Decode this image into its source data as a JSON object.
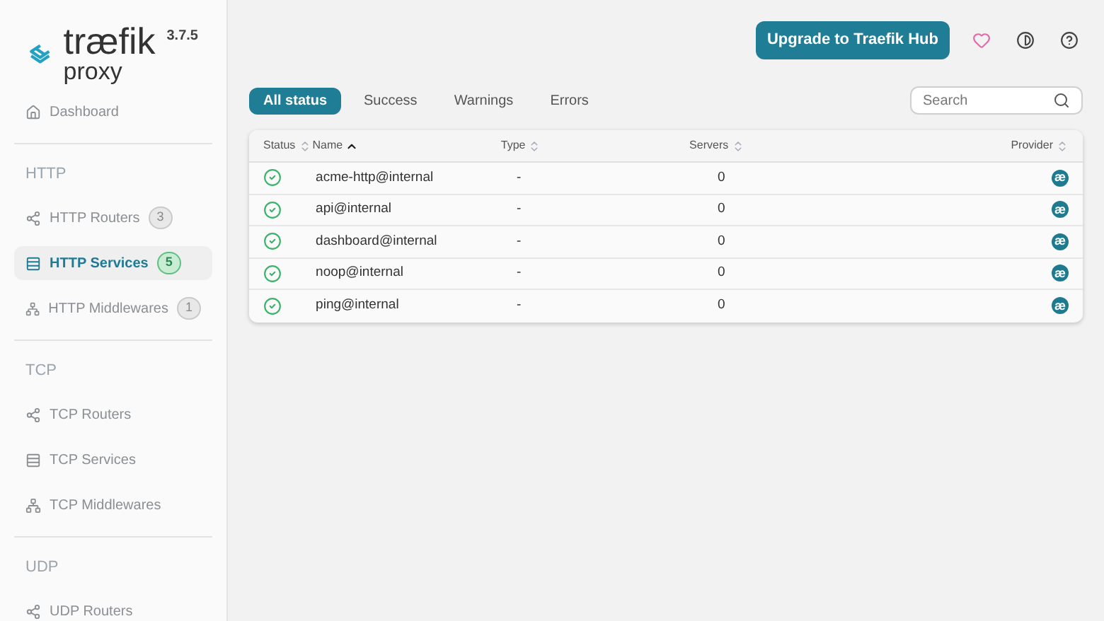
{
  "logo": {
    "name": "træfik",
    "sub": "proxy",
    "version": "3.7.5"
  },
  "sidebar": {
    "items": [
      {
        "kind": "home",
        "label": "Dashboard",
        "selected": false
      },
      {
        "kind": "section",
        "label": "HTTP"
      },
      {
        "kind": "router",
        "label": "HTTP Routers",
        "count": "3",
        "selected": false
      },
      {
        "kind": "service",
        "label": "HTTP Services",
        "count": "5",
        "selected": true
      },
      {
        "kind": "middleware",
        "label": "HTTP Middlewares",
        "count": "1",
        "selected": false
      },
      {
        "kind": "section",
        "label": "TCP"
      },
      {
        "kind": "router",
        "label": "TCP Routers",
        "selected": false
      },
      {
        "kind": "service",
        "label": "TCP Services",
        "selected": false
      },
      {
        "kind": "middleware",
        "label": "TCP Middlewares",
        "selected": false
      },
      {
        "kind": "section",
        "label": "UDP"
      },
      {
        "kind": "router",
        "label": "UDP Routers",
        "selected": false
      }
    ]
  },
  "header": {
    "upgrade_button": "Upgrade to Traefik Hub"
  },
  "tabs": [
    {
      "label": "All status",
      "selected": true
    },
    {
      "label": "Success",
      "selected": false
    },
    {
      "label": "Warnings",
      "selected": false
    },
    {
      "label": "Errors",
      "selected": false
    }
  ],
  "search": {
    "placeholder": "Search"
  },
  "table": {
    "columns": [
      {
        "label": "Status",
        "sorted": false
      },
      {
        "label": "Name",
        "sorted": true
      },
      {
        "label": "Type",
        "sorted": false
      },
      {
        "label": "Servers",
        "sorted": false
      },
      {
        "label": "Provider",
        "sorted": false
      }
    ],
    "rows": [
      {
        "kind": "success",
        "name": "acme-http@internal",
        "type": "-",
        "servers": "0",
        "provider": "æ"
      },
      {
        "kind": "success",
        "name": "api@internal",
        "type": "-",
        "servers": "0",
        "provider": "æ"
      },
      {
        "kind": "success",
        "name": "dashboard@internal",
        "type": "-",
        "servers": "0",
        "provider": "æ"
      },
      {
        "kind": "success",
        "name": "noop@internal",
        "type": "-",
        "servers": "0",
        "provider": "æ"
      },
      {
        "kind": "success",
        "name": "ping@internal",
        "type": "-",
        "servers": "0",
        "provider": "æ"
      }
    ]
  }
}
